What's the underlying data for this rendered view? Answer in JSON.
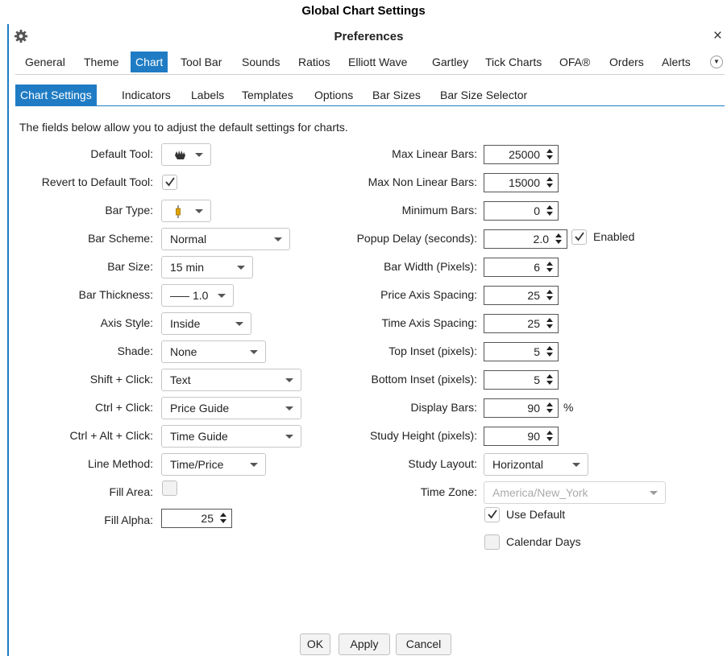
{
  "caption": "Global Chart Settings",
  "window": {
    "title": "Preferences",
    "close_glyph": "×",
    "icon": "gear-icon"
  },
  "main_tabs": [
    {
      "label": "General"
    },
    {
      "label": "Theme"
    },
    {
      "label": "Chart",
      "active": true
    },
    {
      "label": "Tool Bar"
    },
    {
      "label": "Sounds"
    },
    {
      "label": "Ratios"
    },
    {
      "label": "Elliott Wave"
    },
    {
      "label": "Gartley"
    },
    {
      "label": "Tick Charts"
    },
    {
      "label": "OFA®"
    },
    {
      "label": "Orders"
    },
    {
      "label": "Alerts"
    }
  ],
  "sub_tabs": [
    {
      "label": "Chart Settings",
      "active": true
    },
    {
      "label": "Indicators"
    },
    {
      "label": "Labels"
    },
    {
      "label": "Templates"
    },
    {
      "label": "Options"
    },
    {
      "label": "Bar Sizes"
    },
    {
      "label": "Bar Size Selector"
    }
  ],
  "intro": "The fields below allow you to adjust the default settings for charts.",
  "left": {
    "default_tool": {
      "label": "Default Tool:",
      "icon": "hand-icon"
    },
    "revert_default": {
      "label": "Revert to Default Tool:",
      "checked": true
    },
    "bar_type": {
      "label": "Bar Type:",
      "icon": "candlestick-icon"
    },
    "bar_scheme": {
      "label": "Bar Scheme:",
      "value": "Normal"
    },
    "bar_size": {
      "label": "Bar Size:",
      "value": "15 min"
    },
    "bar_thickness": {
      "label": "Bar Thickness:",
      "value": "1.0"
    },
    "axis_style": {
      "label": "Axis Style:",
      "value": "Inside"
    },
    "shade": {
      "label": "Shade:",
      "value": "None"
    },
    "shift_click": {
      "label": "Shift + Click:",
      "value": "Text"
    },
    "ctrl_click": {
      "label": "Ctrl + Click:",
      "value": "Price Guide"
    },
    "ctrl_alt_click": {
      "label": "Ctrl + Alt + Click:",
      "value": "Time Guide"
    },
    "line_method": {
      "label": "Line Method:",
      "value": "Time/Price"
    },
    "fill_area": {
      "label": "Fill Area:",
      "checked": false
    },
    "fill_alpha": {
      "label": "Fill Alpha:",
      "value": "25"
    }
  },
  "right": {
    "max_linear_bars": {
      "label": "Max Linear Bars:",
      "value": "25000"
    },
    "max_non_linear_bars": {
      "label": "Max Non Linear Bars:",
      "value": "15000"
    },
    "minimum_bars": {
      "label": "Minimum Bars:",
      "value": "0"
    },
    "popup_delay": {
      "label": "Popup Delay (seconds):",
      "value": "2.0",
      "enabled_label": "Enabled",
      "enabled": true
    },
    "bar_width": {
      "label": "Bar Width (Pixels):",
      "value": "6"
    },
    "price_axis_spacing": {
      "label": "Price Axis Spacing:",
      "value": "25"
    },
    "time_axis_spacing": {
      "label": "Time Axis Spacing:",
      "value": "25"
    },
    "top_inset": {
      "label": "Top Inset (pixels):",
      "value": "5"
    },
    "bottom_inset": {
      "label": "Bottom Inset (pixels):",
      "value": "5"
    },
    "display_bars": {
      "label": "Display Bars:",
      "value": "90",
      "unit": "%"
    },
    "study_height": {
      "label": "Study Height (pixels):",
      "value": "90"
    },
    "study_layout": {
      "label": "Study Layout:",
      "value": "Horizontal"
    },
    "time_zone": {
      "label": "Time Zone:",
      "value": "America/New_York"
    },
    "use_default": {
      "label": "Use Default",
      "checked": true
    },
    "calendar_days": {
      "label": "Calendar Days",
      "checked": false
    }
  },
  "buttons": {
    "ok": "OK",
    "apply": "Apply",
    "cancel": "Cancel"
  },
  "colors": {
    "accent": "#1f7cc4",
    "candle": "#e0a400"
  }
}
